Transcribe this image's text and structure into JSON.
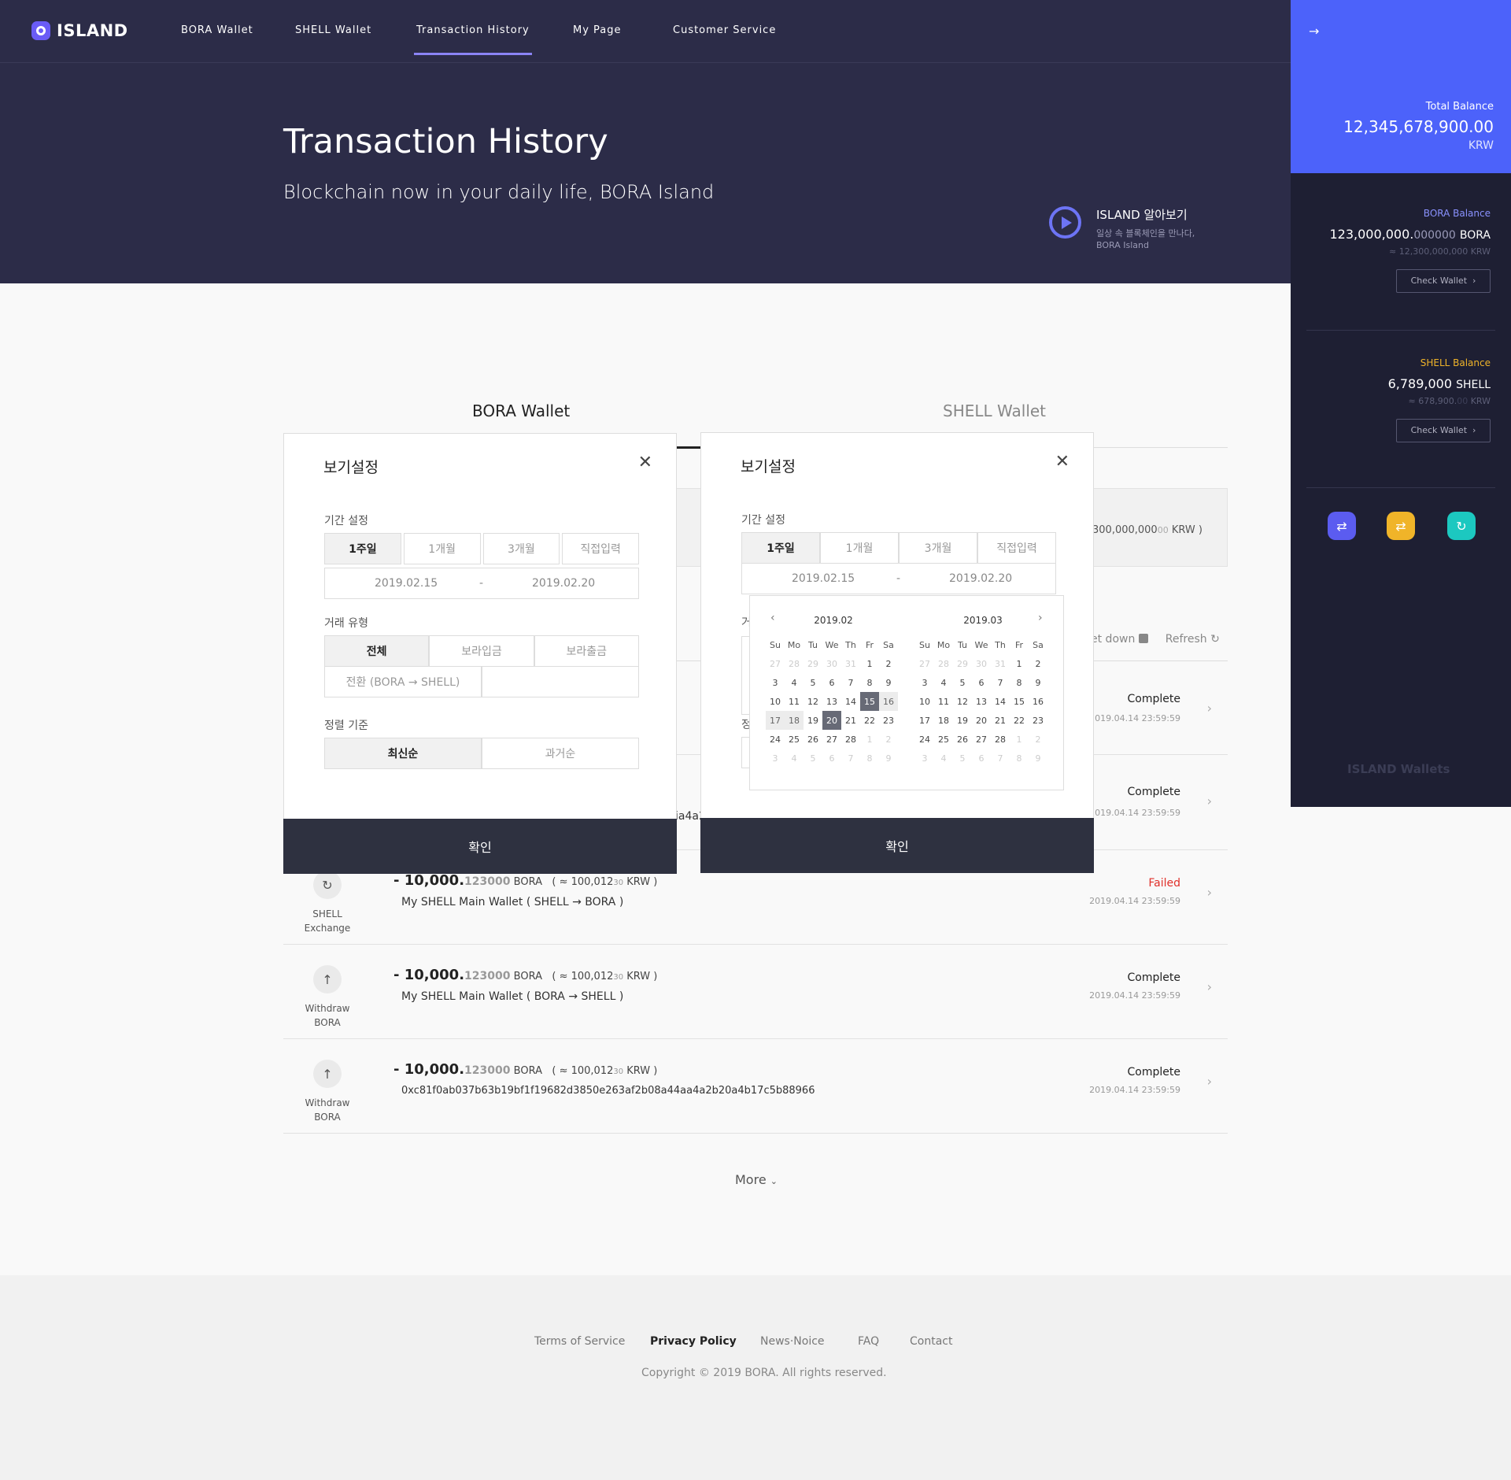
{
  "brand": {
    "logo_text": "ISLAND"
  },
  "nav": {
    "items": [
      "BORA Wallet",
      "SHELL Wallet",
      "Transaction History",
      "My Page",
      "Customer Service"
    ],
    "active_index": 2
  },
  "hero": {
    "title": "Transaction History",
    "subtitle": "Blockchain now in your daily life, BORA Island",
    "promo": {
      "title": "ISLAND 알아보기",
      "desc_line1": "일상 속 블록체인을 만나다,",
      "desc_line2": "BORA Island"
    }
  },
  "panel": {
    "total_label": "Total Balance",
    "total_value": "12,345,678,900.00",
    "total_unit": "KRW",
    "bora": {
      "label": "BORA Balance",
      "amount_main": "123,000,000.",
      "amount_dec": "000000",
      "unit": "BORA",
      "krw": "≈ 12,300,000,000 KRW",
      "button": "Check Wallet"
    },
    "shell": {
      "label": "SHELL Balance",
      "amount_main": "6,789,000",
      "unit": "SHELL",
      "krw_main": "≈ 678,900.",
      "krw_dec": "00",
      "krw_unit": "KRW",
      "button": "Check Wallet"
    },
    "footer": "ISLAND Wallets",
    "colors": {
      "accent": "#4c62fa",
      "bora": "#8a92ff",
      "shell": "#f0b429",
      "icon1": "#5b5cf0",
      "icon2": "#f0b429",
      "icon3": "#1cc8c0"
    }
  },
  "wallet_tabs": [
    "BORA Wallet",
    "SHELL Wallet"
  ],
  "summary": {
    "krw_partial": "300,000,000",
    "krw_dec": "00",
    "krw_unit": "KRW )"
  },
  "tools": {
    "setdown": "et down",
    "refresh": "Refresh"
  },
  "partial_text": "ia4a2",
  "transactions": [
    {
      "type_l1": "",
      "type_l2": "",
      "amount_main": "",
      "amount_dec": "",
      "desc": "",
      "status": "Complete",
      "date": "2019.04.14 23:59:59"
    },
    {
      "type_l1": "",
      "type_l2": "",
      "amount_main": "",
      "amount_dec": "",
      "desc": "",
      "status": "Complete",
      "date": "2019.04.14 23:59:59"
    },
    {
      "type_l1": "SHELL",
      "type_l2": "Exchange",
      "amount_main": "- 10,000.",
      "amount_dec": "123000",
      "unit": "BORA",
      "krw": "( ≈ 100,012",
      "krw_dec": "30",
      "krw_unit": "KRW )",
      "desc": "My SHELL Main Wallet    ( SHELL    →    BORA )",
      "status": "Failed",
      "date": "2019.04.14 23:59:59"
    },
    {
      "type_l1": "Withdraw",
      "type_l2": "BORA",
      "amount_main": "- 10,000.",
      "amount_dec": "123000",
      "unit": "BORA",
      "krw": "( ≈ 100,012",
      "krw_dec": "30",
      "krw_unit": "KRW )",
      "desc": "My SHELL Main Wallet    ( BORA    →    SHELL )",
      "status": "Complete",
      "date": "2019.04.14 23:59:59"
    },
    {
      "type_l1": "Withdraw",
      "type_l2": "BORA",
      "amount_main": "- 10,000.",
      "amount_dec": "123000",
      "unit": "BORA",
      "krw": "( ≈ 100,012",
      "krw_dec": "30",
      "krw_unit": "KRW )",
      "desc": "0xc81f0ab037b63b19bf1f19682d3850e263af2b08a44aa4a2b20a4b17c5b88966",
      "status": "Complete",
      "date": "2019.04.14 23:59:59"
    }
  ],
  "more": "More",
  "footer": {
    "links": [
      "Terms of Service",
      "Privacy Policy",
      "News·Noice",
      "FAQ",
      "Contact"
    ],
    "copyright": "Copyright © 2019 BORA. All rights reserved."
  },
  "modal_left": {
    "title": "보기설정",
    "period_label": "기간 설정",
    "period_opts": [
      "1주일",
      "1개월",
      "3개월",
      "직접입력"
    ],
    "date_from": "2019.02.15",
    "date_sep": "-",
    "date_to": "2019.02.20",
    "type_label": "거래 유형",
    "type_opts": [
      "전체",
      "보라입금",
      "보라출금"
    ],
    "type_opt4": "전환 (BORA → SHELL)",
    "sort_label": "정렬 기준",
    "sort_opts": [
      "최신순",
      "과거순"
    ],
    "confirm": "확인"
  },
  "modal_right": {
    "title": "보기설정",
    "period_label": "기간 설정",
    "period_opts": [
      "1주일",
      "1개월",
      "3개월",
      "직접입력"
    ],
    "date_from": "2019.02.15",
    "date_sep": "-",
    "date_to": "2019.02.20",
    "partial_label1": "거",
    "partial_label2": "정",
    "confirm": "확인"
  },
  "calendar": {
    "weekdays": [
      "Su",
      "Mo",
      "Tu",
      "We",
      "Th",
      "Fr",
      "Sa"
    ],
    "months": [
      {
        "title": "2019.02",
        "days": [
          "27",
          "28",
          "29",
          "30",
          "31",
          "1",
          "2",
          "3",
          "4",
          "5",
          "6",
          "7",
          "8",
          "9",
          "10",
          "11",
          "12",
          "13",
          "14",
          "15",
          "16",
          "17",
          "18",
          "19",
          "20",
          "21",
          "22",
          "23",
          "24",
          "25",
          "26",
          "27",
          "28",
          "1",
          "2",
          "3",
          "4",
          "5",
          "6",
          "7",
          "8",
          "9"
        ],
        "muted": [
          0,
          1,
          2,
          3,
          4,
          33,
          34,
          35,
          36,
          37,
          38,
          39,
          40,
          41
        ],
        "selected": [
          19,
          24
        ],
        "range": [
          20,
          21,
          22
        ]
      },
      {
        "title": "2019.03",
        "days": [
          "27",
          "28",
          "29",
          "30",
          "31",
          "1",
          "2",
          "3",
          "4",
          "5",
          "6",
          "7",
          "8",
          "9",
          "10",
          "11",
          "12",
          "13",
          "14",
          "15",
          "16",
          "17",
          "18",
          "19",
          "20",
          "21",
          "22",
          "23",
          "24",
          "25",
          "26",
          "27",
          "28",
          "1",
          "2",
          "3",
          "4",
          "5",
          "6",
          "7",
          "8",
          "9"
        ],
        "muted": [
          0,
          1,
          2,
          3,
          4,
          33,
          34,
          35,
          36,
          37,
          38,
          39,
          40,
          41
        ],
        "selected": [],
        "range": []
      }
    ]
  }
}
